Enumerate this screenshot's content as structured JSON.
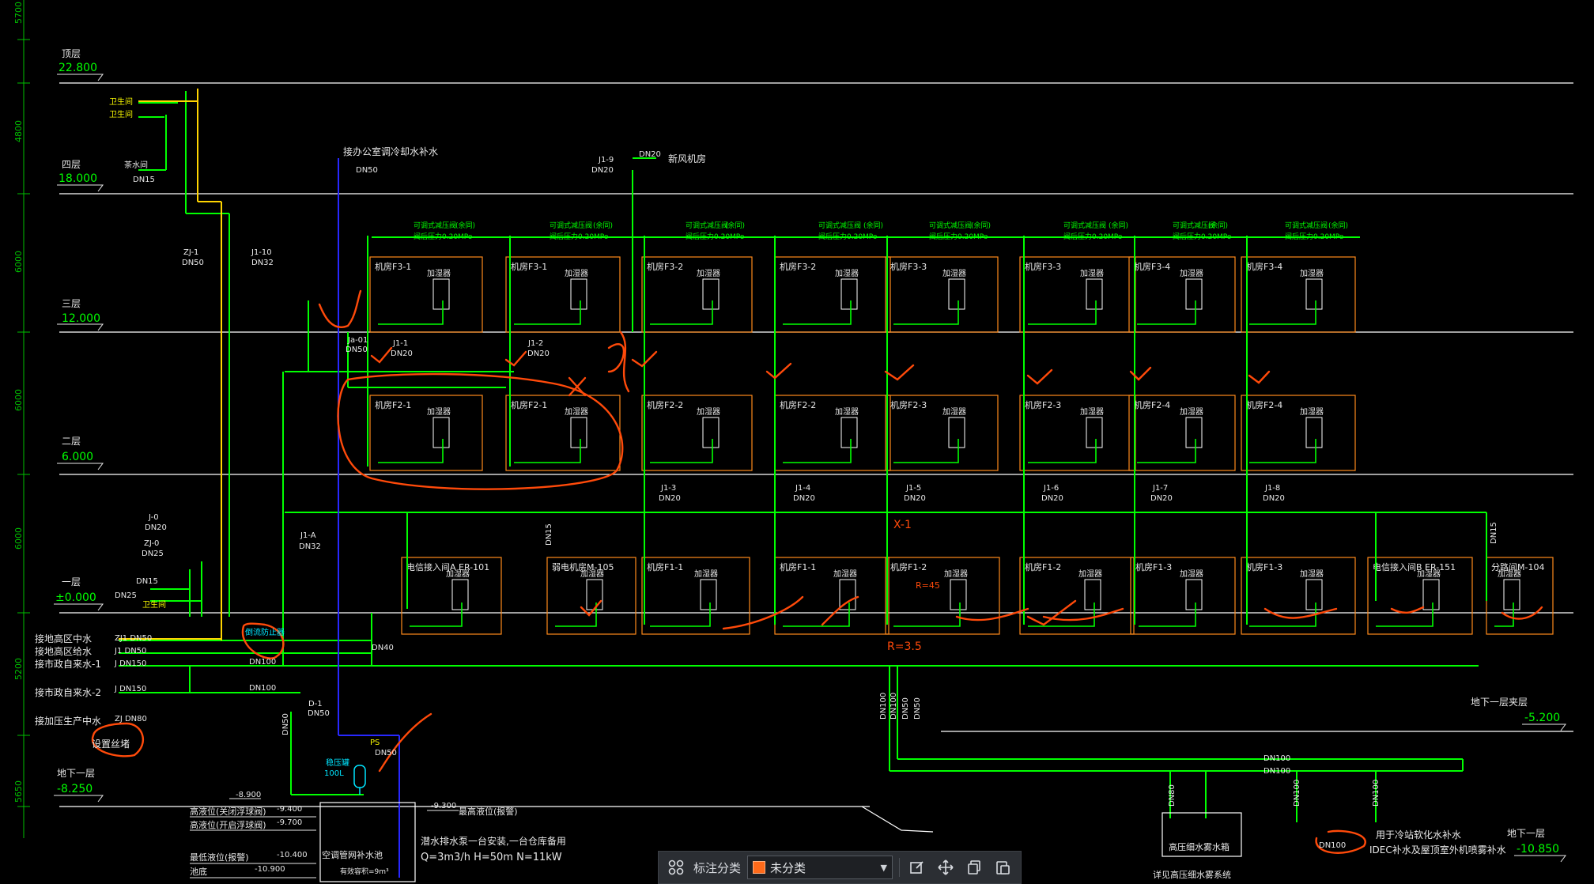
{
  "floors": {
    "roof": {
      "name": "顶层",
      "elev": "22.800"
    },
    "f4": {
      "name": "四层",
      "elev": "18.000"
    },
    "f3": {
      "name": "三层",
      "elev": "12.000"
    },
    "f2": {
      "name": "二层",
      "elev": "6.000"
    },
    "f1": {
      "name": "一层",
      "elev": "±0.000"
    },
    "b1_right": {
      "name": "地下一层夹层",
      "elev": "-5.200"
    },
    "b1_left": {
      "name": "地下一层",
      "elev": "-8.250"
    },
    "b1_bottom": {
      "name": "地下一层",
      "elev": "-10.850"
    }
  },
  "left_scale": [
    "5700",
    "4800",
    "6000",
    "6000",
    "6000",
    "5200",
    "5650"
  ],
  "rooms": {
    "f3": [
      "机房F3-1",
      "机房F3-1",
      "机房F3-2",
      "机房F3-2",
      "机房F3-3",
      "机房F3-3",
      "机房F3-4",
      "机房F3-4"
    ],
    "f2": [
      "机房F2-1",
      "机房F2-1",
      "机房F2-2",
      "机房F2-2",
      "机房F2-3",
      "机房F2-3",
      "机房F2-4",
      "机房F2-4"
    ],
    "f1": [
      "电信接入间A ER-101",
      "弱电机房M-105",
      "机房F1-1",
      "机房F1-1",
      "机房F1-2",
      "机房F1-2",
      "机房F1-3",
      "机房F1-3",
      "电信接入间B ER-151",
      "分路间M-104"
    ]
  },
  "humidifier": "加湿器",
  "valve_note_1": "可调式减压阀",
  "valve_note_2": "阀后压力0.20MPo",
  "valve_note_3": "(余同)",
  "risers": {
    "j1_1": {
      "name": "J1-1",
      "size": "DN20"
    },
    "j1_2": {
      "name": "J1-2",
      "size": "DN20"
    },
    "j1_3": {
      "name": "J1-3",
      "size": "DN20"
    },
    "j1_4": {
      "name": "J1-4",
      "size": "DN20"
    },
    "j1_5": {
      "name": "J1-5",
      "size": "DN20"
    },
    "j1_6": {
      "name": "J1-6",
      "size": "DN20"
    },
    "j1_7": {
      "name": "J1-7",
      "size": "DN20"
    },
    "j1_8": {
      "name": "J1-8",
      "size": "DN20"
    },
    "j1_9": {
      "name": "J1-9",
      "size": "DN20"
    },
    "j1_10": {
      "name": "J1-10",
      "size": "DN32"
    },
    "j1_a": {
      "name": "J1-A",
      "size": "DN32"
    },
    "zj_1": {
      "name": "ZJ-1",
      "size": "DN50"
    },
    "ja_01": {
      "name": "Ja-01",
      "size": "DN50"
    },
    "j_0": {
      "name": "J-0",
      "size": "DN20"
    },
    "zj_0": {
      "name": "ZJ-0",
      "size": "DN25"
    },
    "d_1": {
      "name": "D-1",
      "size": "DN50"
    }
  },
  "labels": {
    "toilet1": "卫生间",
    "toilet2": "卫生间",
    "tea_room": "茶水间",
    "tea_dn": "DN15",
    "fresh_air": "新风机房",
    "fresh_dn": "DN20",
    "ac_makeup": "接办公室调冷却水补水",
    "ac_makeup_dn": "DN50",
    "f1_toilet": "卫生间",
    "dn15": "DN15",
    "dn25": "DN25",
    "dn15_v": "DN15",
    "dn15_v2": "DN15",
    "dn40": "DN40",
    "dn50_v": "DN50",
    "dn100_a": "DN100",
    "dn100_b": "DN100",
    "dn100_c": "DN100",
    "dn100_d": "DN100",
    "dn100_v1": "DN100",
    "dn100_v2": "DN100",
    "dn50_v2": "DN50",
    "dn50_v3": "DN50",
    "dn100_v3": "DN100",
    "dn100_v4": "DN100",
    "dn80": "DN80",
    "ps_dn": "DN50",
    "ps": "PS",
    "meter_cloud": "DN100",
    "meter_cloud_b": "DN100",
    "tank_small": "稳压罐",
    "tank_vol": "100L",
    "in1": "接地高区中水",
    "in1_dn": "ZJ1 DN50",
    "in2": "接地高区给水",
    "in2_dn": "J1 DN50",
    "in3": "接市政自来水-1",
    "in3_dn": "J DN150",
    "in4": "接市政自来水-2",
    "in4_dn": "J DN150",
    "in5": "接加压生产中水",
    "in5_dn": "ZJ DN80",
    "cloud_note": "设置丝堵",
    "meter_label": "倒流防止器",
    "wl1_name": "高液位(关闭浮球阀)",
    "wl1": "-9.400",
    "wl2_name": "高液位(开启浮球阀)",
    "wl2": "-9.700",
    "wl3_name": "最低液位(报警)",
    "wl3": "-10.400",
    "wl4_name": "池底",
    "wl4": "-10.900",
    "wl0": "-8.900",
    "wl_high": "-9.300",
    "wl_high_name": "最高液位(报警)",
    "pool_name": "空调管网补水池",
    "pool_vol": "有效容积=9m³",
    "pump_note1": "潜水排水泵一台安装,一台仓库备用",
    "pump_note2": "Q=3m3/h  H=50m  N=11kW",
    "hp_tank": "高压细水雾水箱",
    "hp_sys": "详见高压细水雾系统",
    "right_note1": "用于冷站软化水补水",
    "right_note2": "IDEC补水及屋顶室外机喷雾补水",
    "anno1": "X-1",
    "anno2": "R=45",
    "anno3": "R=3.5"
  },
  "toolbar": {
    "label": "标注分类",
    "value": "未分类",
    "accent": "#ff6a1a"
  },
  "colors": {
    "background": "#000000",
    "pipe": "#00ff00",
    "room": "#ff8a1a",
    "markup": "#ff4a0a",
    "yellow_pipe": "#ffd400",
    "blue_pipe": "#2020ff",
    "cyan": "#00e5ff",
    "text_yellow": "#f5f500"
  }
}
